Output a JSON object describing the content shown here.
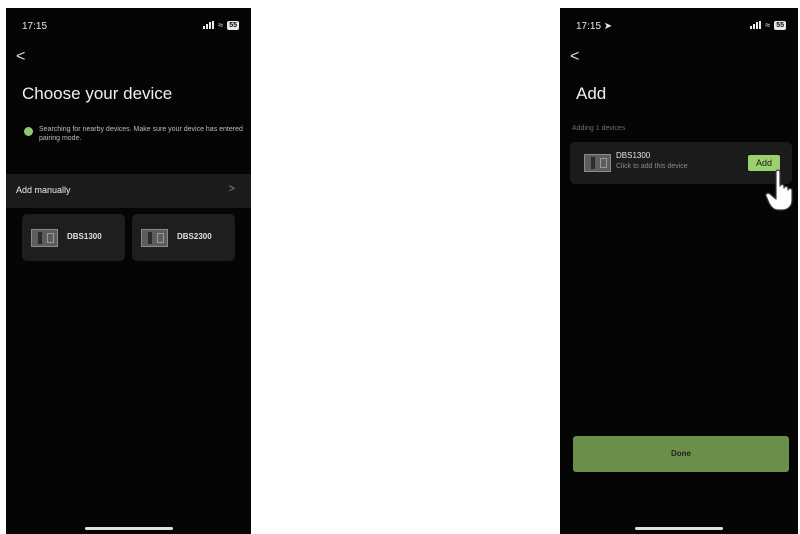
{
  "left_screen": {
    "status_time": "17:15",
    "battery": "55",
    "back_glyph": "<",
    "title": "Choose your device",
    "searching_text": "Searching for nearby devices. Make sure your device has entered pairing mode.",
    "add_manually_label": "Add manually",
    "add_manually_chevron": ">",
    "devices": [
      {
        "name": "DBS1300",
        "icon": "device-icon"
      },
      {
        "name": "DBS2300",
        "icon": "device-icon"
      }
    ]
  },
  "right_screen": {
    "status_time": "17:15 ➤",
    "battery": "55",
    "back_glyph": "<",
    "title": "Add",
    "section_label": "Adding 1 devices",
    "device": {
      "name": "DBS1300",
      "hint": "Click to add this device",
      "add_label": "Add"
    },
    "done_label": "Done"
  },
  "colors": {
    "screen_bg": "#050505",
    "card_bg": "#1e1e1e",
    "accent_green": "#9bd06f",
    "done_green": "#6c8f4b",
    "search_dot": "#8fc86f"
  }
}
